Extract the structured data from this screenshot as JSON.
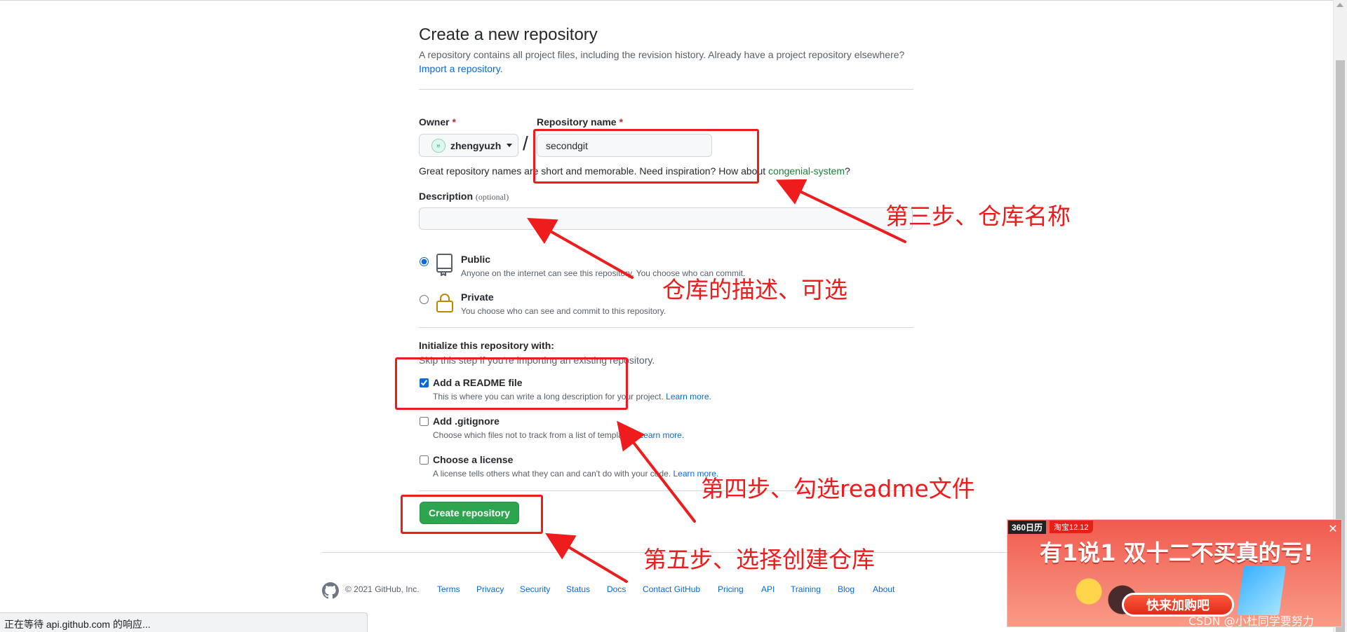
{
  "page": {
    "title": "Create a new repository",
    "subtitle": "A repository contains all project files, including the revision history. Already have a project repository elsewhere?",
    "import_link": "Import a repository."
  },
  "owner": {
    "label": "Owner",
    "required_mark": "*",
    "value": "zhengyuzh"
  },
  "repo_name": {
    "label": "Repository name",
    "required_mark": "*",
    "value": "secondgit",
    "separator": "/"
  },
  "hint": {
    "text": "Great repository names are short and memorable. Need inspiration? How about ",
    "suggestion": "congenial-system",
    "suffix": "?"
  },
  "description": {
    "label": "Description",
    "optional": "(optional)",
    "value": ""
  },
  "visibility": {
    "selected": "public",
    "public": {
      "title": "Public",
      "desc": "Anyone on the internet can see this repository. You choose who can commit."
    },
    "private": {
      "title": "Private",
      "desc": "You choose who can see and commit to this repository."
    }
  },
  "init": {
    "title": "Initialize this repository with:",
    "subtitle": "Skip this step if you're importing an existing repository.",
    "readme": {
      "title": "Add a README file",
      "desc": "This is where you can write a long description for your project. ",
      "learn": "Learn more.",
      "checked": true
    },
    "gitignore": {
      "title": "Add .gitignore",
      "desc": "Choose which files not to track from a list of templates. ",
      "learn": "Learn more.",
      "checked": false
    },
    "license": {
      "title": "Choose a license",
      "desc": "A license tells others what they can and can't do with your code. ",
      "learn": "Learn more.",
      "checked": false
    }
  },
  "create_button": "Create repository",
  "footer": {
    "copyright": "© 2021 GitHub, Inc.",
    "links": [
      "Terms",
      "Privacy",
      "Security",
      "Status",
      "Docs",
      "Contact GitHub",
      "Pricing",
      "API",
      "Training",
      "Blog",
      "About"
    ]
  },
  "statusbar": "正在等待 api.github.com 的响应...",
  "annotations": {
    "step3": "第三步、仓库名称",
    "desc": "仓库的描述、可选",
    "step4": "第四步、勾选readme文件",
    "step5": "第五步、选择创建仓库"
  },
  "ad": {
    "brand": "360日历",
    "tag": "淘宝12.12",
    "headline": "有1说1 双十二不买真的亏!",
    "cta": "快来加购吧",
    "close": "✕"
  },
  "watermark": "CSDN @小杜同学要努力",
  "colors": {
    "primary_button": "#2da44e",
    "link": "#0969da",
    "annotation": "#ee1c1c",
    "suggestion": "#1a7f37"
  }
}
